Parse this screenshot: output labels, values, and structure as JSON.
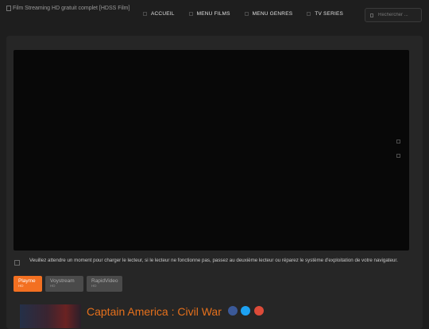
{
  "header": {
    "logo_alt": "Film Streaming HD gratuit complet [HDSS Film]",
    "nav": [
      {
        "label": "ACCUEIL"
      },
      {
        "label": "MENU FILMS"
      },
      {
        "label": "MENU GENRES"
      },
      {
        "label": "TV SERIES"
      }
    ],
    "search_placeholder": "Rechercher ..."
  },
  "player": {
    "notice": "Veuillez attendre un moment pour charger le lecteur, si le lecteur ne fonctionne pas, passez au deuxième lecteur ou réparez le système d'exploitation de votre navigateur.",
    "servers": [
      {
        "name": "Playme",
        "quality": "HD",
        "active": true
      },
      {
        "name": "Voystream",
        "quality": "HD",
        "active": false
      },
      {
        "name": "RapidVideo",
        "quality": "HD",
        "active": false
      }
    ]
  },
  "movie": {
    "title": "Captain America : Civil War",
    "share_icons": [
      "facebook-icon",
      "twitter-icon",
      "google-plus-icon"
    ],
    "colors": {
      "accent": "#f37021",
      "facebook": "#3b5998",
      "twitter": "#1da1f2",
      "google": "#dd4b39"
    }
  }
}
